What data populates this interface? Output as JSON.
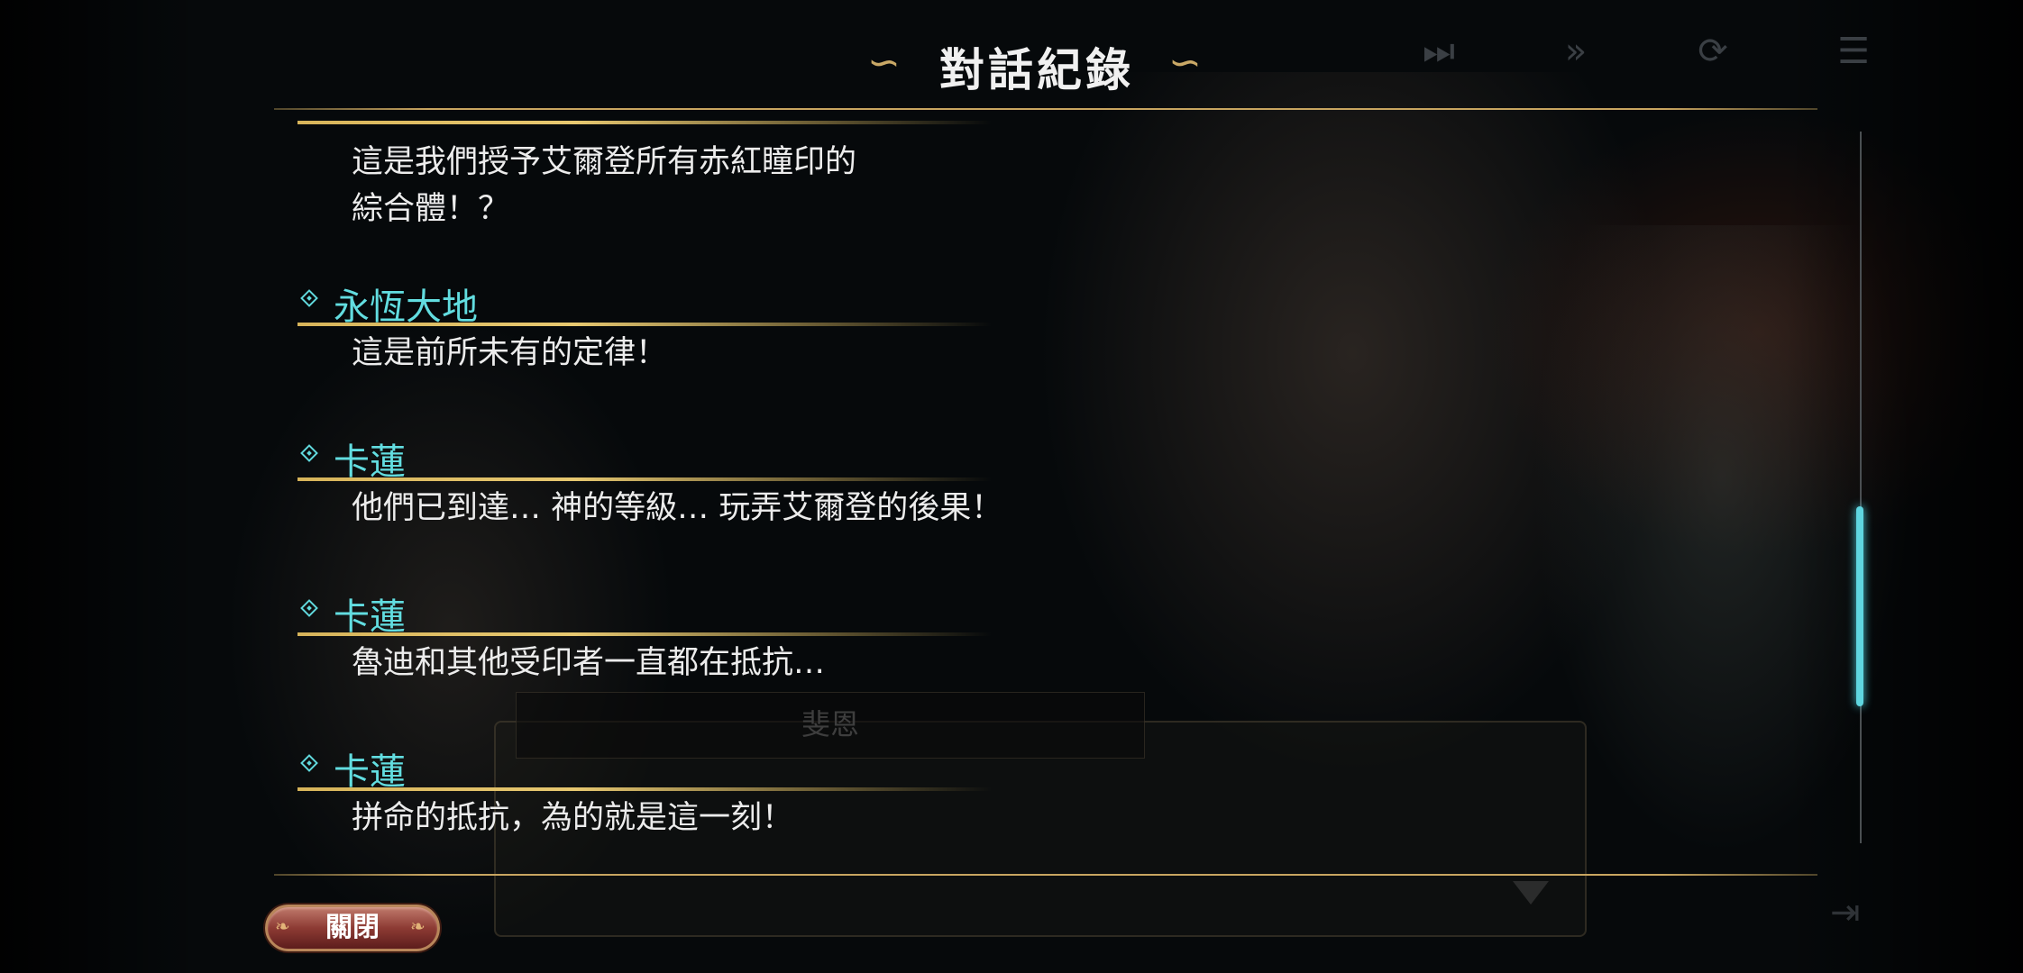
{
  "header": {
    "title": "對話紀錄"
  },
  "controls": [
    {
      "name": "fast-forward-icon",
      "glyph": "⏭"
    },
    {
      "name": "skip-icon",
      "glyph": "»"
    },
    {
      "name": "auto-icon",
      "glyph": "⟳"
    },
    {
      "name": "log-icon",
      "glyph": "☰"
    }
  ],
  "background": {
    "underlying_speaker": "斐恩"
  },
  "log": {
    "entries": [
      {
        "speaker": "",
        "lines": "這是我們授予艾爾登所有赤紅瞳印的\n綜合體！？"
      },
      {
        "speaker": "永恆大地",
        "lines": "這是前所未有的定律！"
      },
      {
        "speaker": "卡蓮",
        "lines": "他們已到達… 神的等級… 玩弄艾爾登的後果！"
      },
      {
        "speaker": "卡蓮",
        "lines": "魯迪和其他受印者一直都在抵抗…"
      },
      {
        "speaker": "卡蓮",
        "lines": "拼命的抵抗，為的就是這一刻！"
      }
    ]
  },
  "footer": {
    "close_label": "關閉"
  },
  "colors": {
    "speaker": "#62dde0",
    "gold": "#c8a560",
    "scrollbar": "#5fd6e0"
  }
}
